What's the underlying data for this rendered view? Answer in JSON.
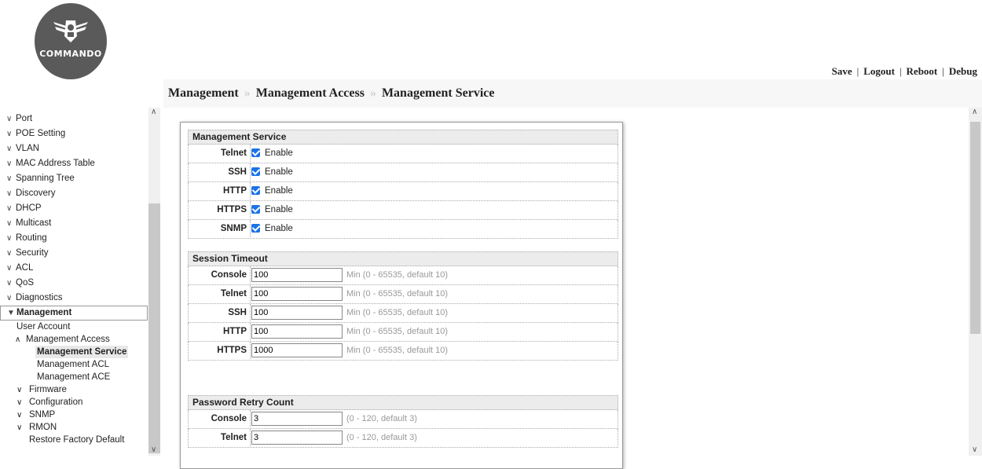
{
  "brand": {
    "logo_text": "COMMANDO"
  },
  "toplinks": {
    "save": "Save",
    "logout": "Logout",
    "reboot": "Reboot",
    "debug": "Debug",
    "sep": "|"
  },
  "breadcrumb": {
    "items": [
      "Management",
      "Management Access",
      "Management Service"
    ],
    "arrow": "»"
  },
  "sidebar": {
    "items": [
      {
        "label": "Port"
      },
      {
        "label": "POE Setting"
      },
      {
        "label": "VLAN"
      },
      {
        "label": "MAC Address Table"
      },
      {
        "label": "Spanning Tree"
      },
      {
        "label": "Discovery"
      },
      {
        "label": "DHCP"
      },
      {
        "label": "Multicast"
      },
      {
        "label": "Routing"
      },
      {
        "label": "Security"
      },
      {
        "label": "ACL"
      },
      {
        "label": "QoS"
      },
      {
        "label": "Diagnostics"
      }
    ],
    "active": {
      "label": "Management"
    },
    "sub": {
      "user_account": "User Account",
      "mgmt_access": "Management Access",
      "mgmt_service": "Management Service",
      "mgmt_acl": "Management ACL",
      "mgmt_ace": "Management ACE",
      "firmware": "Firmware",
      "configuration": "Configuration",
      "snmp": "SNMP",
      "rmon": "RMON",
      "restore": "Restore Factory Default"
    }
  },
  "service": {
    "title": "Management Service",
    "rows": [
      {
        "label": "Telnet",
        "value": "Enable"
      },
      {
        "label": "SSH",
        "value": "Enable"
      },
      {
        "label": "HTTP",
        "value": "Enable"
      },
      {
        "label": "HTTPS",
        "value": "Enable"
      },
      {
        "label": "SNMP",
        "value": "Enable"
      }
    ]
  },
  "timeout": {
    "title": "Session Timeout",
    "rows": [
      {
        "label": "Console",
        "value": "100",
        "hint": "Min (0 - 65535, default 10)"
      },
      {
        "label": "Telnet",
        "value": "100",
        "hint": "Min (0 - 65535, default 10)"
      },
      {
        "label": "SSH",
        "value": "100",
        "hint": "Min (0 - 65535, default 10)"
      },
      {
        "label": "HTTP",
        "value": "100",
        "hint": "Min (0 - 65535, default 10)"
      },
      {
        "label": "HTTPS",
        "value": "1000",
        "hint": "Min (0 - 65535, default 10)"
      }
    ]
  },
  "retry": {
    "title": "Password Retry Count",
    "rows": [
      {
        "label": "Console",
        "value": "3",
        "hint": "(0 - 120, default 3)"
      },
      {
        "label": "Telnet",
        "value": "3",
        "hint": "(0 - 120, default 3)"
      }
    ]
  }
}
